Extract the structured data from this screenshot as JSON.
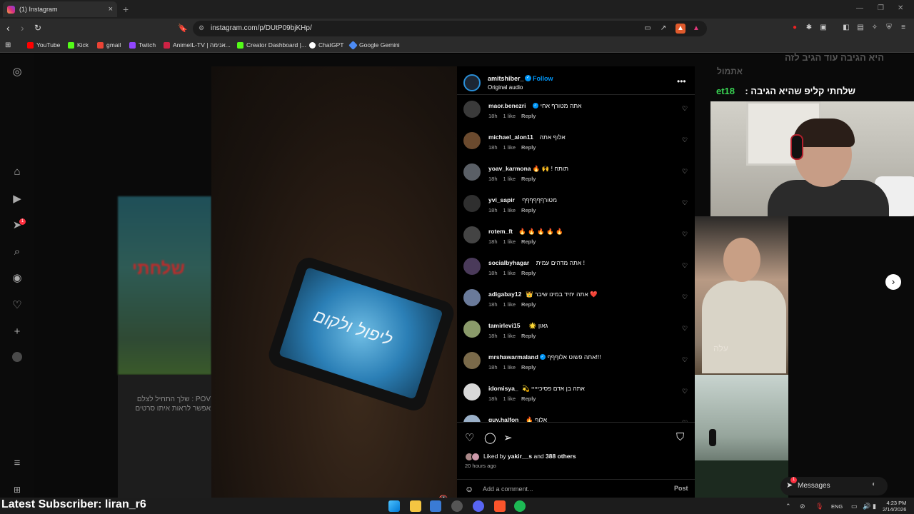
{
  "browser": {
    "tab_title": "(1) Instagram",
    "url": "instagram.com/p/DUtP09bjKHp/",
    "bookmarks": [
      {
        "label": "YouTube",
        "color": "#ff0000"
      },
      {
        "label": "Kick",
        "color": "#53fc18"
      },
      {
        "label": "gmail",
        "color": "#ea4335"
      },
      {
        "label": "Twitch",
        "color": "#9146ff"
      },
      {
        "label": "AnimeIL-TV | אנימה...",
        "color": "#c24"
      },
      {
        "label": "Creator Dashboard |...",
        "color": "#53fc18"
      },
      {
        "label": "ChatGPT",
        "color": "#ffffff"
      },
      {
        "label": "Google Gemini",
        "color": "#4c8bf5"
      }
    ]
  },
  "post": {
    "author": "amitshiber_",
    "follow_label": "Follow",
    "audio": "Original audio",
    "phone_title": "ליפול ולקום",
    "comments": [
      {
        "user": "maor.benezri",
        "verified": true,
        "text": "אתה מטורף אחי",
        "time": "18h",
        "likes": "1 like",
        "reply": "Reply",
        "avatar": "#3a3a3a"
      },
      {
        "user": "michael_alon11",
        "verified": false,
        "text": "אלוף אתה",
        "time": "18h",
        "likes": "1 like",
        "reply": "Reply",
        "avatar": "#6b4a2e"
      },
      {
        "user": "yoav_karmona",
        "verified": false,
        "text": "🔥 🙌 ! תותח",
        "time": "18h",
        "likes": "1 like",
        "reply": "Reply",
        "avatar": "#5a5f66"
      },
      {
        "user": "yvi_sapir",
        "verified": false,
        "text": "מטורףףףףףף",
        "time": "18h",
        "likes": "1 like",
        "reply": "Reply",
        "avatar": "#2f2f2f"
      },
      {
        "user": "rotem_ft",
        "verified": false,
        "text": "🔥 🔥 🔥 🔥 🔥",
        "time": "18h",
        "likes": "1 like",
        "reply": "Reply",
        "avatar": "#444"
      },
      {
        "user": "socialbyhagar",
        "verified": false,
        "text": "אתה מדהים עמית !",
        "time": "18h",
        "likes": "1 like",
        "reply": "Reply",
        "avatar": "#4a3a5a"
      },
      {
        "user": "adigabay12",
        "verified": false,
        "text": "👑 אתה יחיד במינו שיבר ❤️",
        "time": "18h",
        "likes": "1 like",
        "reply": "Reply",
        "avatar": "#6a7a9a"
      },
      {
        "user": "tamirlevi15",
        "verified": false,
        "text": "🌟 גאון",
        "time": "18h",
        "likes": "1 like",
        "reply": "Reply",
        "avatar": "#8a9a6a"
      },
      {
        "user": "mrshawarmaland",
        "verified": true,
        "text": "אתה פשוט אלוףףף!!!",
        "time": "18h",
        "likes": "1 like",
        "reply": "Reply",
        "avatar": "#7a6a4a"
      },
      {
        "user": "idomisya_",
        "verified": false,
        "text": "💫 אתה בן אדם פסיכייייי",
        "time": "18h",
        "likes": "1 like",
        "reply": "Reply",
        "avatar": "#d8d8d8"
      },
      {
        "user": "guy.halfon",
        "verified": false,
        "text": "🔥 אלוף",
        "time": "",
        "likes": "",
        "reply": "",
        "avatar": "#9ab0c8"
      }
    ],
    "liked_by_prefix": "Liked by",
    "liked_by_user": "yakir__s",
    "liked_by_and": "and",
    "liked_by_others": "388 others",
    "time_ago": "20 hours ago",
    "comment_placeholder": "Add a comment...",
    "post_label": "Post"
  },
  "background": {
    "tile_hebrew": "שלחתי",
    "tile_pov": "POV : שלך התחיל לצלם אפשר לראות איתו סרטים",
    "reel_label": "עלה"
  },
  "stream": {
    "faded_top": "היא הגיבה עוד הגיב לזה",
    "faded_second": "אתמול",
    "message_user": "et18",
    "message_text": ": שלחתי קליפ שהיא הגיבה",
    "latest_subscriber": "Latest Subscriber: liran_r6"
  },
  "messages_label": "Messages",
  "messages_badge": "1",
  "nav_badge": "1",
  "taskbar": {
    "lang": "ENG",
    "time": "4:23 PM",
    "date": "2/14/2026"
  }
}
